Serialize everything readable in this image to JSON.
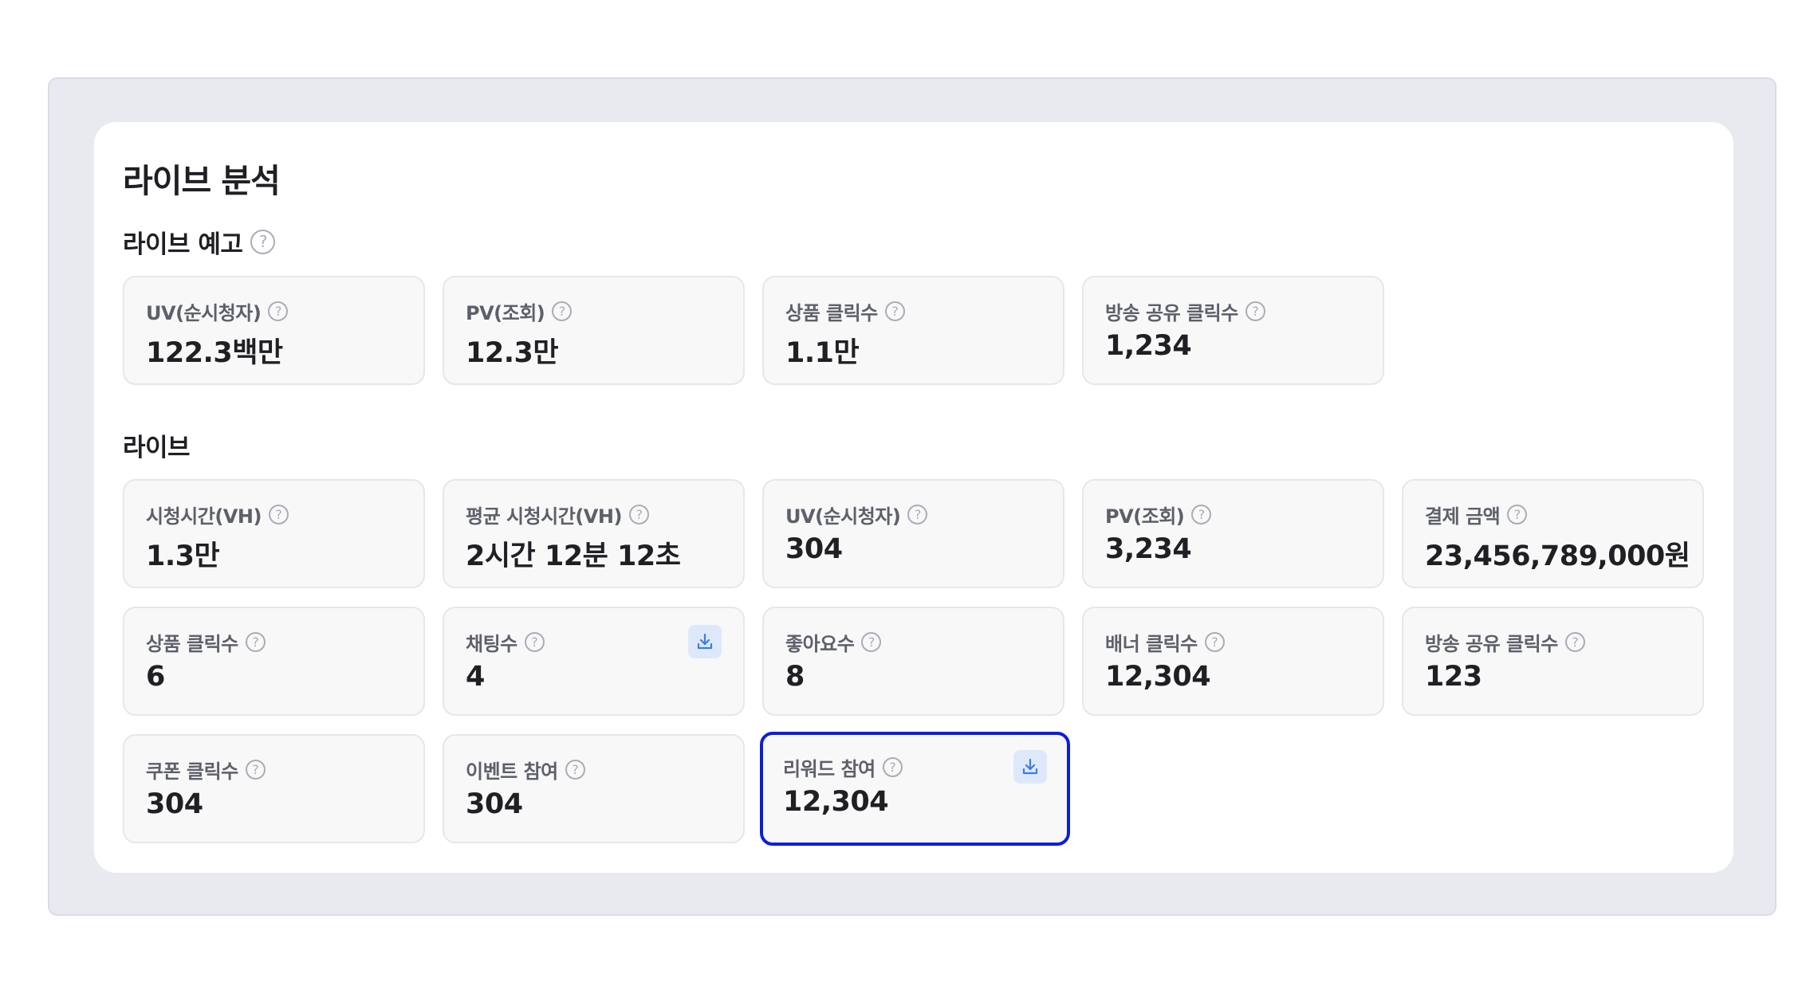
{
  "page_title": "라이브 분석",
  "help_glyph": "?",
  "sections": {
    "preview": {
      "title": "라이브 예고",
      "metrics": [
        {
          "label": "UV(순시청자)",
          "value": "122.3백만"
        },
        {
          "label": "PV(조회)",
          "value": "12.3만"
        },
        {
          "label": "상품 클릭수",
          "value": "1.1만"
        },
        {
          "label": "방송 공유 클릭수",
          "value": "1,234"
        }
      ]
    },
    "live": {
      "title": "라이브",
      "metrics": [
        {
          "label": "시청시간(VH)",
          "value": "1.3만"
        },
        {
          "label": "평균 시청시간(VH)",
          "value": "2시간 12분 12초"
        },
        {
          "label": "UV(순시청자)",
          "value": "304"
        },
        {
          "label": "PV(조회)",
          "value": "3,234"
        },
        {
          "label": "결제 금액",
          "value": "23,456,789,000원"
        },
        {
          "label": "상품 클릭수",
          "value": "6"
        },
        {
          "label": "채팅수",
          "value": "4",
          "download": true
        },
        {
          "label": "좋아요수",
          "value": "8"
        },
        {
          "label": "배너 클릭수",
          "value": "12,304"
        },
        {
          "label": "방송 공유 클릭수",
          "value": "123"
        },
        {
          "label": "쿠폰 클릭수",
          "value": "304"
        },
        {
          "label": "이벤트 참여",
          "value": "304"
        },
        {
          "label": "리워드 참여",
          "value": "12,304",
          "download": true,
          "selected": true
        }
      ]
    }
  },
  "icons": {
    "help": "help-circle-icon",
    "download": "download-icon"
  },
  "colors": {
    "outer_background": "#e8eaef",
    "card_background": "#ffffff",
    "metric_background": "#f8f8f9",
    "selected_border": "#0c1fd8",
    "download_accent": "#3d7be8"
  }
}
